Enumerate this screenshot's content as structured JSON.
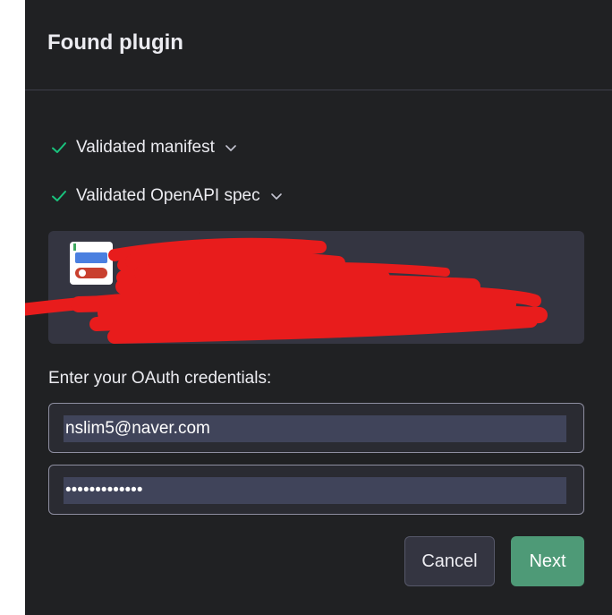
{
  "dialog": {
    "title": "Found plugin"
  },
  "validations": [
    {
      "label": "Validated manifest",
      "status": "success",
      "icon": "check-icon"
    },
    {
      "label": "Validated OpenAPI spec",
      "status": "success",
      "icon": "check-icon"
    }
  ],
  "plugin_card": {
    "logo_icon": "plugin-logo-icon",
    "redacted": true
  },
  "oauth": {
    "label": "Enter your OAuth credentials:",
    "email_value": "nslim5@naver.com",
    "secret_value": "•••••••••••••"
  },
  "buttons": {
    "cancel_label": "Cancel",
    "next_label": "Next"
  },
  "colors": {
    "background": "#202123",
    "card": "#343541",
    "success": "#19c37d",
    "next_button": "#4e9a77",
    "redaction": "#e81c1c"
  }
}
